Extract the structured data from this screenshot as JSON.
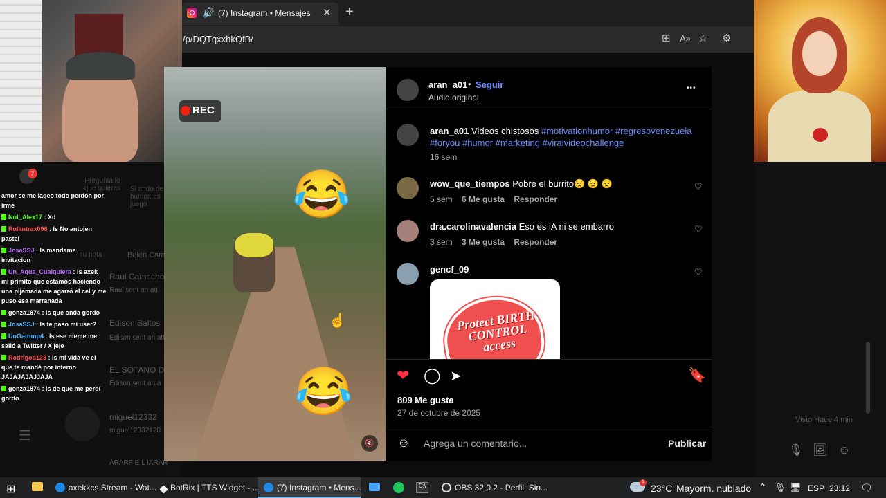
{
  "browser": {
    "tab_title": "(7) Instagram • Mensajes",
    "tab_close": "✕",
    "tab_new": "+",
    "url": "/p/DQTqxxhkQfB/",
    "icons": [
      "instagram-icon",
      "speaker-icon",
      "app-install-icon",
      "read-aloud-icon",
      "favorite-star-icon",
      "extensions-icon"
    ]
  },
  "chat": {
    "badge_count": "7",
    "messages": [
      {
        "user": "",
        "text": "amor se me lageo todo perdón por irme"
      },
      {
        "user": "Not_Alex17",
        "text": ": Xd"
      },
      {
        "user": "Rulantrax096",
        "text": ": ls No antojen pastel"
      },
      {
        "user": "JosaSSJ",
        "text": ": ls mandame invitacion"
      },
      {
        "user": "Un_Aqua_Cualquiera",
        "text": ": ls axek mi primito que estamos haciendo una pijamada me agarró el cel y me puso esa marranada"
      },
      {
        "user": "gonza1874",
        "text": ": ls que onda gordo"
      },
      {
        "user": "JosaSSJ",
        "text": ": ls te paso mi user?"
      },
      {
        "user": "UnGatomp4",
        "text": ": ls ese meme me salió a Twitter / X jeje"
      },
      {
        "user": "Rodrigod123",
        "text": ": ls mi vida ve el que te mandé por interno JAJAJAJAJJAJA"
      },
      {
        "user": "gonza1874",
        "text": ": ls de que me perdí gordo"
      }
    ],
    "colors": {
      "nick_green": "#53fc18",
      "nick_red": "#ff4d4d",
      "nick_purple": "#b56cff",
      "nick_blue": "#4fb6ff"
    },
    "background_threads": [
      {
        "name": "Pregunta lo que quieras",
        "sub": ""
      },
      {
        "name": "Si ando de humor, es juego",
        "sub": ""
      },
      {
        "name": "Tu nota",
        "sub": ""
      },
      {
        "name": "Belen Cam",
        "sub": ""
      },
      {
        "name": "Raul Camacho",
        "sub": "Raul sent an att"
      },
      {
        "name": "Edison Saltos",
        "sub": "Edison sent an att"
      },
      {
        "name": "EL SOTANO D",
        "sub": "Edison sent an a"
      },
      {
        "name": "miguel12332",
        "sub": "miguel12332120"
      },
      {
        "name": "ARARF E L IARAR",
        "sub": ""
      }
    ]
  },
  "overlay": {
    "rec_label": "REC",
    "mute_icon": "🔇"
  },
  "post": {
    "author": "aran_a01",
    "dot": "•",
    "follow": "Seguir",
    "audio": "Audio original",
    "more_icon": "•••",
    "caption_user": "aran_a01",
    "caption_text": "Videos chistosos",
    "caption_tags_1": "#motivationhumor #regresovenezuela",
    "caption_tags_2": "#foryou #humor #marketing #viralvideochallenge",
    "caption_age": "16 sem",
    "comments": [
      {
        "user": "wow_que_tiempos",
        "text": "Pobre el burrito😟 😟 😟",
        "age": "5 sem",
        "likes": "6 Me gusta",
        "reply": "Responder"
      },
      {
        "user": "dra.carolinavalencia",
        "text": "Eso es iA ni se embarro",
        "age": "3 sem",
        "likes": "3 Me gusta",
        "reply": "Responder"
      },
      {
        "user": "gencf_09",
        "text": "",
        "age": "",
        "likes": "",
        "reply": ""
      }
    ],
    "attachment_text": "Protect BIRTH CONTROL access",
    "likes_count": "809 Me gusta",
    "date": "27 de octubre de 2025",
    "comment_placeholder": "Agrega un comentario...",
    "publish": "Publicar",
    "liked": true,
    "like_color": "#ff3040"
  },
  "right_side": {
    "visto": "Visto Hace 4 min"
  },
  "taskbar": {
    "items": [
      {
        "label": "axekkcs Stream - Wat...",
        "active": false
      },
      {
        "label": "BotRix | TTS Widget - ...",
        "active": false
      },
      {
        "label": "(7) Instagram • Mens...",
        "active": true
      },
      {
        "label": "OBS 32.0.2 - Perfil: Sin...",
        "active": false
      }
    ],
    "weather_temp": "23°C",
    "weather_text": "Mayorm. nublado",
    "language": "ESP",
    "time": "23:12",
    "weather_badge": "1"
  }
}
